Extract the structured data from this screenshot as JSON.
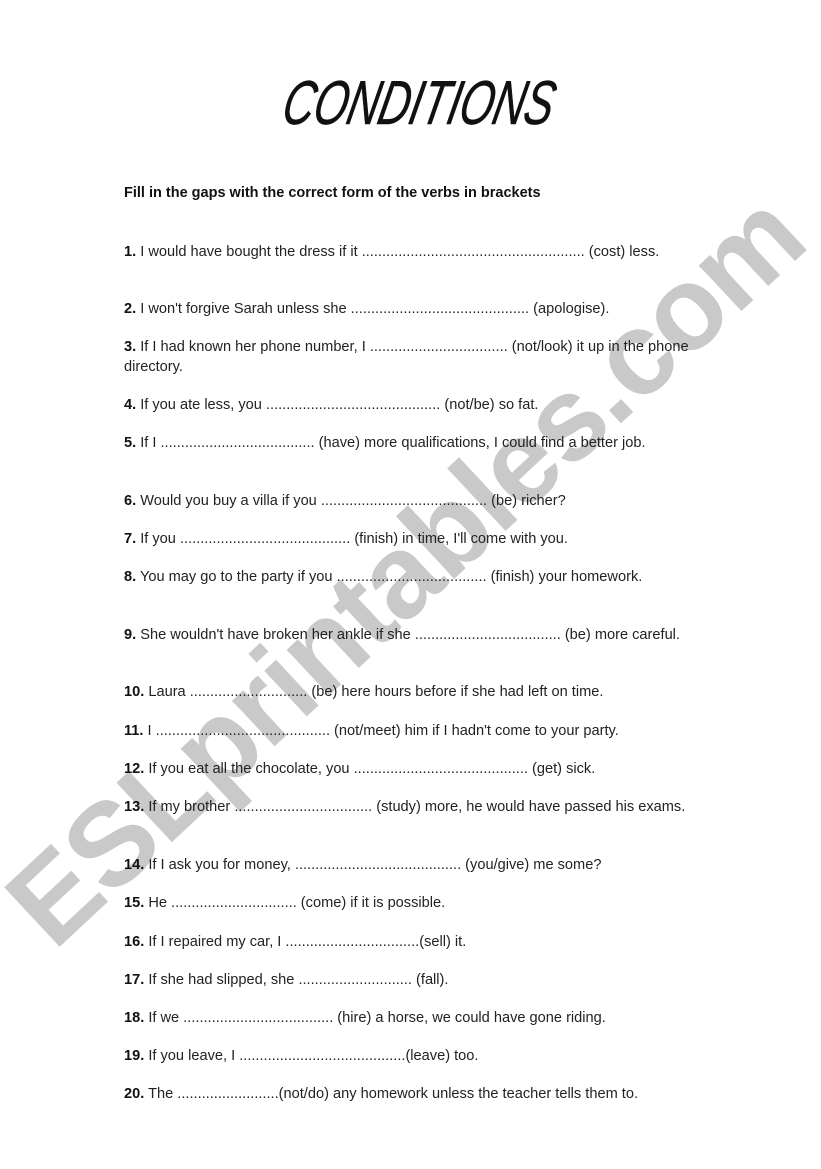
{
  "title": "CONDITIONS",
  "watermark": "ESLprintables.com",
  "instruction": "Fill in the gaps with the correct form of the verbs in brackets",
  "questions": [
    {
      "num": "1.",
      "text": " I would have bought the dress if it ....................................................... (cost) less."
    },
    {
      "num": "2.",
      "text": " I won't forgive Sarah unless she ............................................ (apologise)."
    },
    {
      "num": "3.",
      "text": "  If I had known her phone number, I .................................. (not/look) it up in the phone directory."
    },
    {
      "num": "4.",
      "text": "  If you ate less, you ........................................... (not/be) so fat."
    },
    {
      "num": "5.",
      "text": "  If I ...................................... (have) more qualifications, I could find a better job."
    },
    {
      "num": "6.",
      "text": "  Would you buy a villa if you ......................................... (be) richer?"
    },
    {
      "num": "7.",
      "text": "  If you .......................................... (finish) in time, I'll come with you."
    },
    {
      "num": "8.",
      "text": "  You may go to the party if you ..................................... (finish) your homework."
    },
    {
      "num": "9.",
      "text": "  She wouldn't have broken her ankle if she .................................... (be) more careful."
    },
    {
      "num": "10.",
      "text": " Laura ............................. (be) here hours before if she had left on time."
    },
    {
      "num": "11.",
      "text": " I ........................................... (not/meet) him if I hadn't come to your party."
    },
    {
      "num": "12.",
      "text": " If you eat all the chocolate, you ........................................... (get) sick."
    },
    {
      "num": "13.",
      "text": " If my brother .................................. (study) more, he would have passed his exams."
    },
    {
      "num": "14.",
      "text": " If I ask you for money, ......................................... (you/give) me some?"
    },
    {
      "num": "15.",
      "text": " He ............................... (come) if it is possible."
    },
    {
      "num": "16.",
      "text": "  If I repaired my car, I .................................(sell) it."
    },
    {
      "num": "17.",
      "text": "  If she had slipped, she ............................ (fall)."
    },
    {
      "num": "18.",
      "text": "  If we ..................................... (hire) a horse, we could  have gone riding."
    },
    {
      "num": "19.",
      "text": "  If you leave, I .........................................(leave) too."
    },
    {
      "num": "20.",
      "text": " The .........................(not/do) any homework unless the teacher tells them to."
    }
  ]
}
